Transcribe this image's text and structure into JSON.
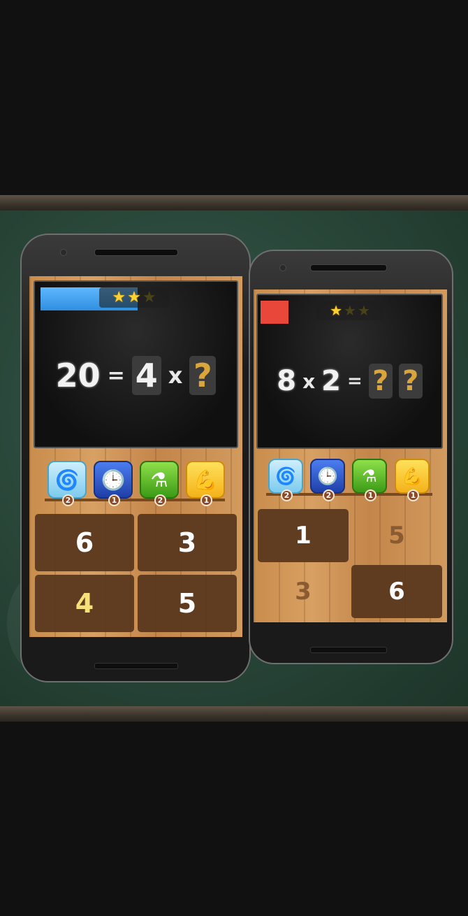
{
  "phone1": {
    "stars": [
      "★",
      "★",
      "★"
    ],
    "progress_fraction": 0.55,
    "equation": {
      "left": "20",
      "eq": "=",
      "factor": "4",
      "op": "x",
      "unknown": "?"
    },
    "powerups": [
      {
        "icon": "swirl-icon",
        "glyph": "🌀",
        "count": "2"
      },
      {
        "icon": "clock-icon",
        "glyph": "🕒",
        "count": "1"
      },
      {
        "icon": "potion-icon",
        "glyph": "⚗",
        "count": "2"
      },
      {
        "icon": "muscle-icon",
        "glyph": "💪",
        "count": "1"
      }
    ],
    "answers": [
      "6",
      "3",
      "4",
      "5"
    ]
  },
  "phone2": {
    "stars": [
      "★",
      "★",
      "★"
    ],
    "equation": {
      "a": "8",
      "op": "x",
      "b": "2",
      "eq": "=",
      "unknown1": "?",
      "unknown2": "?"
    },
    "powerups": [
      {
        "icon": "swirl-icon",
        "glyph": "🌀",
        "count": "2"
      },
      {
        "icon": "clock-icon",
        "glyph": "🕒",
        "count": "2"
      },
      {
        "icon": "potion-icon",
        "glyph": "⚗",
        "count": "1"
      },
      {
        "icon": "muscle-icon",
        "glyph": "💪",
        "count": "1"
      }
    ],
    "answers": [
      "1",
      "5",
      "3",
      "6"
    ]
  },
  "colors": {
    "chalkboard": "#284538",
    "wood": "#d29a5d",
    "progress": "#3a9be8",
    "timeout": "#e8473a",
    "star": "#ffd232"
  }
}
